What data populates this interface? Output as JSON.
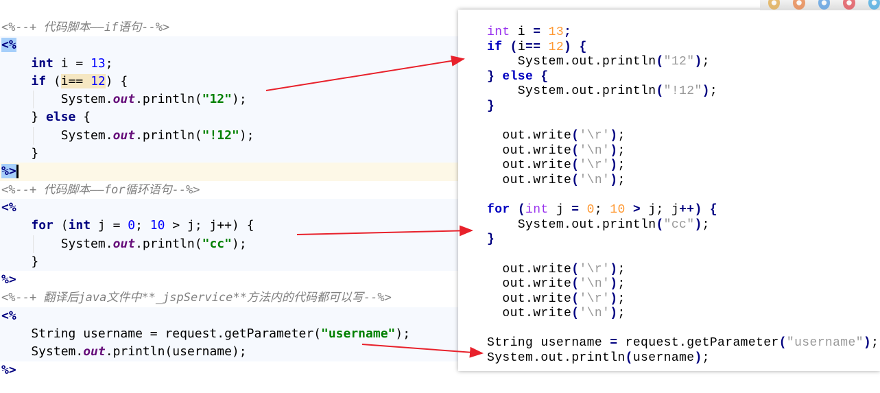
{
  "left_editor": {
    "lines": [
      {
        "kind": "comment",
        "tokens": [
          [
            "<%--+ 代码脚本——if语句--%>",
            "cmt"
          ]
        ]
      },
      {
        "kind": "code",
        "tokens": [
          [
            "<%",
            "tag hl"
          ]
        ]
      },
      {
        "kind": "code",
        "tokens": [
          [
            "    ",
            ""
          ],
          [
            "int",
            "kw"
          ],
          [
            " i = ",
            ""
          ],
          [
            "13",
            "num"
          ],
          [
            ";",
            ""
          ]
        ]
      },
      {
        "kind": "code",
        "tokens": [
          [
            "    ",
            ""
          ],
          [
            "if",
            "kw"
          ],
          [
            " (",
            ""
          ],
          [
            "i== ",
            "hlexp"
          ],
          [
            "12",
            "num hlexp"
          ],
          [
            ") {",
            ""
          ]
        ]
      },
      {
        "kind": "code",
        "guide": true,
        "tokens": [
          [
            "        System.",
            ""
          ],
          [
            "out",
            "fld"
          ],
          [
            ".println(",
            ""
          ],
          [
            "\"12\"",
            "str"
          ],
          [
            ");",
            ""
          ]
        ]
      },
      {
        "kind": "code",
        "tokens": [
          [
            "    } ",
            ""
          ],
          [
            "else",
            "kw"
          ],
          [
            " {",
            ""
          ]
        ]
      },
      {
        "kind": "code",
        "guide": true,
        "tokens": [
          [
            "        System.",
            ""
          ],
          [
            "out",
            "fld"
          ],
          [
            ".println(",
            ""
          ],
          [
            "\"!12\"",
            "str"
          ],
          [
            ");",
            ""
          ]
        ]
      },
      {
        "kind": "code",
        "tokens": [
          [
            "    }",
            ""
          ]
        ]
      },
      {
        "kind": "cur",
        "caret": true,
        "tokens": [
          [
            "%>",
            "tag hl"
          ]
        ]
      },
      {
        "kind": "comment",
        "tokens": [
          [
            "<%--+ 代码脚本——for循环语句--%>",
            "cmt"
          ]
        ]
      },
      {
        "kind": "code",
        "tokens": [
          [
            "<%",
            "tag"
          ]
        ]
      },
      {
        "kind": "code",
        "tokens": [
          [
            "    ",
            ""
          ],
          [
            "for",
            "kw"
          ],
          [
            " (",
            ""
          ],
          [
            "int",
            "kw"
          ],
          [
            " j = ",
            ""
          ],
          [
            "0",
            "num"
          ],
          [
            "; ",
            ""
          ],
          [
            "10",
            "num"
          ],
          [
            " > j; j++) {",
            ""
          ]
        ]
      },
      {
        "kind": "code",
        "guide": true,
        "tokens": [
          [
            "        System.",
            ""
          ],
          [
            "out",
            "fld"
          ],
          [
            ".println(",
            ""
          ],
          [
            "\"cc\"",
            "str"
          ],
          [
            ");",
            ""
          ]
        ]
      },
      {
        "kind": "code",
        "tokens": [
          [
            "    }",
            ""
          ]
        ]
      },
      {
        "kind": "plain",
        "tokens": [
          [
            "%>",
            "tag"
          ]
        ]
      },
      {
        "kind": "comment",
        "tokens": [
          [
            "<%--+ 翻译后java文件中**_jspService**方法内的代码都可以写--%>",
            "cmt"
          ]
        ]
      },
      {
        "kind": "code",
        "tokens": [
          [
            "<%",
            "tag"
          ]
        ]
      },
      {
        "kind": "code",
        "tokens": [
          [
            "    String username = request.getParameter(",
            ""
          ],
          [
            "\"username\"",
            "str"
          ],
          [
            ");",
            ""
          ]
        ]
      },
      {
        "kind": "code",
        "tokens": [
          [
            "    System.",
            ""
          ],
          [
            "out",
            "fld"
          ],
          [
            ".println(username);",
            ""
          ]
        ]
      },
      {
        "kind": "plain",
        "tokens": [
          [
            "%>",
            "tag"
          ]
        ]
      }
    ]
  },
  "right_translated": {
    "lines": [
      [
        [
          "int",
          "type"
        ],
        [
          " i ",
          ""
        ],
        [
          "=",
          "pun"
        ],
        [
          " ",
          ""
        ],
        [
          "13",
          "num"
        ],
        [
          ";",
          "pun"
        ]
      ],
      [
        [
          "if",
          "kw"
        ],
        [
          " ",
          ""
        ],
        [
          "(",
          "pun"
        ],
        [
          "i",
          ""
        ],
        [
          "==",
          "pun"
        ],
        [
          " ",
          ""
        ],
        [
          "12",
          "num"
        ],
        [
          ")",
          "pun"
        ],
        [
          " ",
          ""
        ],
        [
          "{",
          "pun"
        ]
      ],
      [
        [
          "    System.out.println",
          ""
        ],
        [
          "(",
          "pun"
        ],
        [
          "\"12\"",
          "str"
        ],
        [
          ")",
          "pun"
        ],
        [
          ";",
          ""
        ]
      ],
      [
        [
          "}",
          "pun"
        ],
        [
          " ",
          ""
        ],
        [
          "else",
          "kw"
        ],
        [
          " ",
          ""
        ],
        [
          "{",
          "pun"
        ]
      ],
      [
        [
          "    System.out.println",
          ""
        ],
        [
          "(",
          "pun"
        ],
        [
          "\"!12\"",
          "str"
        ],
        [
          ")",
          "pun"
        ],
        [
          ";",
          ""
        ]
      ],
      [
        [
          "}",
          "pun"
        ]
      ],
      [],
      [
        [
          "  out.write",
          ""
        ],
        [
          "(",
          "pun"
        ],
        [
          "'\\r'",
          "str"
        ],
        [
          ")",
          "pun"
        ],
        [
          ";",
          ""
        ]
      ],
      [
        [
          "  out.write",
          ""
        ],
        [
          "(",
          "pun"
        ],
        [
          "'\\n'",
          "str"
        ],
        [
          ")",
          "pun"
        ],
        [
          ";",
          ""
        ]
      ],
      [
        [
          "  out.write",
          ""
        ],
        [
          "(",
          "pun"
        ],
        [
          "'\\r'",
          "str"
        ],
        [
          ")",
          "pun"
        ],
        [
          ";",
          ""
        ]
      ],
      [
        [
          "  out.write",
          ""
        ],
        [
          "(",
          "pun"
        ],
        [
          "'\\n'",
          "str"
        ],
        [
          ")",
          "pun"
        ],
        [
          ";",
          ""
        ]
      ],
      [],
      [
        [
          "for",
          "kw"
        ],
        [
          " ",
          ""
        ],
        [
          "(",
          "pun"
        ],
        [
          "int",
          "type"
        ],
        [
          " j ",
          ""
        ],
        [
          "=",
          "pun"
        ],
        [
          " ",
          ""
        ],
        [
          "0",
          "num"
        ],
        [
          "; ",
          ""
        ],
        [
          "10",
          "num"
        ],
        [
          " ",
          ""
        ],
        [
          ">",
          "pun"
        ],
        [
          " j; j",
          ""
        ],
        [
          "++",
          "pun"
        ],
        [
          ")",
          "pun"
        ],
        [
          " ",
          ""
        ],
        [
          "{",
          "pun"
        ]
      ],
      [
        [
          "    System.out.println",
          ""
        ],
        [
          "(",
          "pun"
        ],
        [
          "\"cc\"",
          "str"
        ],
        [
          ")",
          "pun"
        ],
        [
          ";",
          ""
        ]
      ],
      [
        [
          "}",
          "pun"
        ]
      ],
      [],
      [
        [
          "  out.write",
          ""
        ],
        [
          "(",
          "pun"
        ],
        [
          "'\\r'",
          "str"
        ],
        [
          ")",
          "pun"
        ],
        [
          ";",
          ""
        ]
      ],
      [
        [
          "  out.write",
          ""
        ],
        [
          "(",
          "pun"
        ],
        [
          "'\\n'",
          "str"
        ],
        [
          ")",
          "pun"
        ],
        [
          ";",
          ""
        ]
      ],
      [
        [
          "  out.write",
          ""
        ],
        [
          "(",
          "pun"
        ],
        [
          "'\\r'",
          "str"
        ],
        [
          ")",
          "pun"
        ],
        [
          ";",
          ""
        ]
      ],
      [
        [
          "  out.write",
          ""
        ],
        [
          "(",
          "pun"
        ],
        [
          "'\\n'",
          "str"
        ],
        [
          ")",
          "pun"
        ],
        [
          ";",
          ""
        ]
      ],
      [],
      [
        [
          "String username ",
          ""
        ],
        [
          "=",
          "pun"
        ],
        [
          " request.getParameter",
          ""
        ],
        [
          "(",
          "pun"
        ],
        [
          "\"username\"",
          "str"
        ],
        [
          ")",
          "pun"
        ],
        [
          ";",
          ""
        ]
      ],
      [
        [
          "System.out.println",
          ""
        ],
        [
          "(",
          "pun"
        ],
        [
          "username",
          ""
        ],
        [
          ")",
          "pun"
        ],
        [
          ";",
          ""
        ]
      ]
    ]
  },
  "browser_icons": [
    {
      "name": "chrome-icon",
      "color": "#e0a030"
    },
    {
      "name": "firefox-icon",
      "color": "#e8702a"
    },
    {
      "name": "safari-icon",
      "color": "#3d8fe0"
    },
    {
      "name": "opera-icon",
      "color": "#e0303a"
    },
    {
      "name": "edge-icon",
      "color": "#2a9ee0"
    }
  ],
  "colors": {
    "arrow": "#e8212b",
    "keyword": "#000080",
    "string": "#008000",
    "number": "#0000ff"
  }
}
